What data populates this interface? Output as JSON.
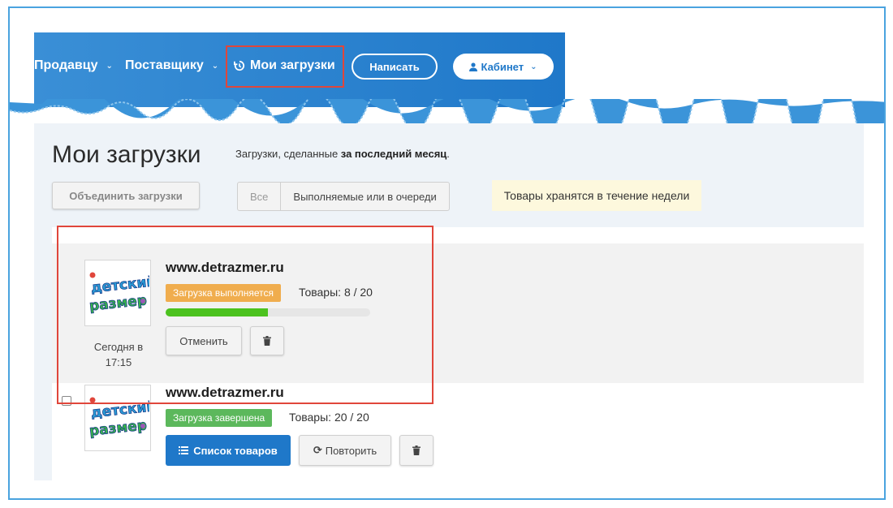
{
  "nav": {
    "seller_label": "Продавцу",
    "supplier_label": "Поставщику",
    "downloads_label": "Мои загрузки",
    "write_label": "Написать",
    "cabinet_label": "Кабинет",
    "gradient_start": "#3a8fd6",
    "gradient_end": "#1f78c9",
    "highlight_color": "#e0463b"
  },
  "page": {
    "title": "Мои загрузки",
    "subtitle_prefix": "Загрузки, сделанные ",
    "subtitle_bold": "за последний месяц",
    "subtitle_suffix": "."
  },
  "toolbar": {
    "merge_label": "Объединить загрузки",
    "filter_all": "Все",
    "filter_active": "Выполняемые или в очереди",
    "notice": "Товары хранятся в течение недели"
  },
  "downloads": [
    {
      "domain": "www.detrazmer.ru",
      "status": "Загрузка выполняется",
      "status_color": "#f0ad4e",
      "count": "Товары: 8 / 20",
      "progress_percent": 50,
      "time": "Сегодня в 17:15",
      "cancel_label": "Отменить",
      "logo_text_1": "детский",
      "logo_text_2": "размер"
    },
    {
      "domain": "www.detrazmer.ru",
      "status": "Загрузка завершена",
      "status_color": "#5cb85c",
      "count": "Товары: 20 / 20",
      "products_label": "Список товаров",
      "retry_label": "Повторить",
      "logo_text_1": "детский",
      "logo_text_2": "размер"
    }
  ]
}
